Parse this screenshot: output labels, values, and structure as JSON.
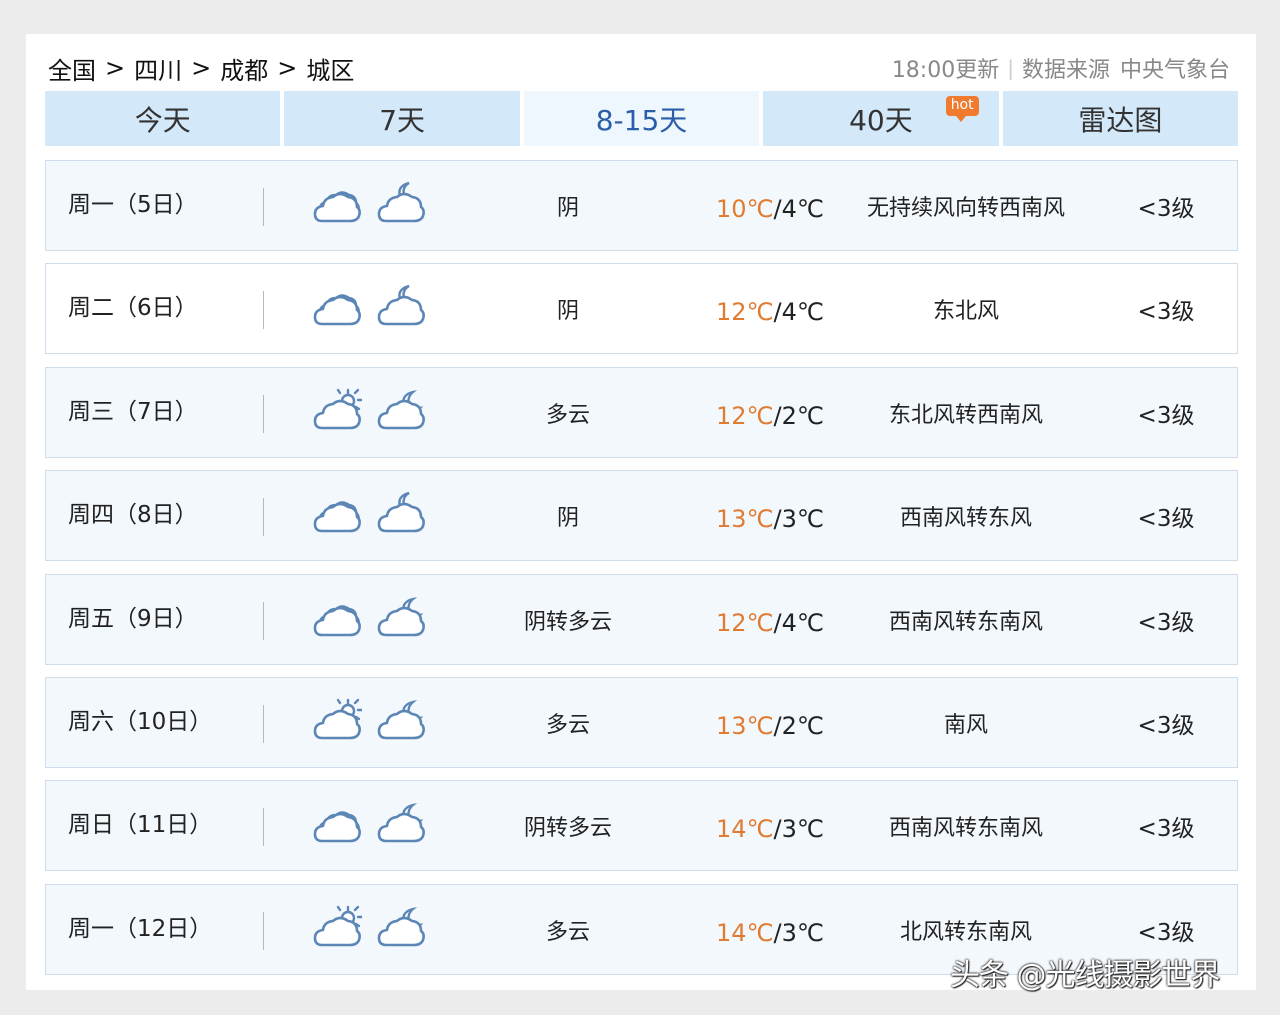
{
  "breadcrumb": {
    "items": [
      "全国",
      "四川",
      "成都",
      "城区"
    ],
    "separator": ">"
  },
  "meta": {
    "update_time": "18:00更新",
    "source_label": "数据来源",
    "source": "中央气象台"
  },
  "tabs": [
    {
      "label": "今天"
    },
    {
      "label": "7天"
    },
    {
      "label": "8-15天",
      "active": true
    },
    {
      "label": "40天",
      "badge": "hot"
    },
    {
      "label": "雷达图"
    }
  ],
  "forecast": [
    {
      "day": "周一（5日）",
      "day_icon": "overcast-icon",
      "night_icon": "overcast-night-icon",
      "desc": "阴",
      "high": "10℃",
      "low": "/4℃",
      "wind": "无持续风向转西南风",
      "level": "<3级"
    },
    {
      "day": "周二（6日）",
      "day_icon": "overcast-icon",
      "night_icon": "overcast-night-icon",
      "desc": "阴",
      "high": "12℃",
      "low": "/4℃",
      "wind": "东北风",
      "level": "<3级"
    },
    {
      "day": "周三（7日）",
      "day_icon": "partly-cloudy-day-icon",
      "night_icon": "partly-cloudy-night-icon",
      "desc": "多云",
      "high": "12℃",
      "low": "/2℃",
      "wind": "东北风转西南风",
      "level": "<3级"
    },
    {
      "day": "周四（8日）",
      "day_icon": "overcast-icon",
      "night_icon": "overcast-night-icon",
      "desc": "阴",
      "high": "13℃",
      "low": "/3℃",
      "wind": "西南风转东风",
      "level": "<3级"
    },
    {
      "day": "周五（9日）",
      "day_icon": "overcast-icon",
      "night_icon": "partly-cloudy-night-icon",
      "desc": "阴转多云",
      "high": "12℃",
      "low": "/4℃",
      "wind": "西南风转东南风",
      "level": "<3级"
    },
    {
      "day": "周六（10日）",
      "day_icon": "partly-cloudy-day-icon",
      "night_icon": "partly-cloudy-night-icon",
      "desc": "多云",
      "high": "13℃",
      "low": "/2℃",
      "wind": "南风",
      "level": "<3级"
    },
    {
      "day": "周日（11日）",
      "day_icon": "overcast-icon",
      "night_icon": "partly-cloudy-night-icon",
      "desc": "阴转多云",
      "high": "14℃",
      "low": "/3℃",
      "wind": "西南风转东南风",
      "level": "<3级"
    },
    {
      "day": "周一（12日）",
      "day_icon": "partly-cloudy-day-icon",
      "night_icon": "partly-cloudy-night-icon",
      "desc": "多云",
      "high": "14℃",
      "low": "/3℃",
      "wind": "北风转东南风",
      "level": "<3级"
    }
  ],
  "watermark": "头条 @光线摄影世界",
  "colors": {
    "tab_bg": "#d3e8f9",
    "tab_active_text": "#2a5ea8",
    "high_temp": "#e07b32",
    "icon_stroke": "#5b86b6"
  }
}
